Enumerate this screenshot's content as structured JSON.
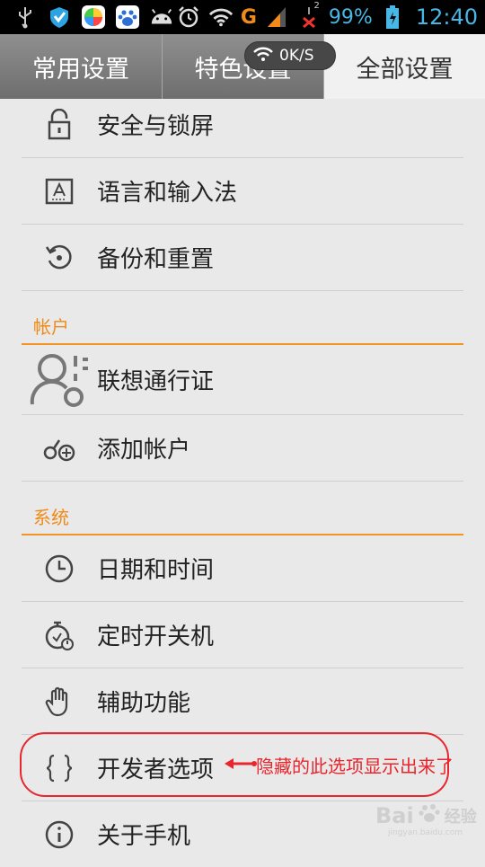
{
  "status_bar": {
    "battery": "99%",
    "time": "12:40",
    "network": "G",
    "signal_sub": "2",
    "icons": [
      "usb-icon",
      "shield-icon",
      "app-store-icon",
      "baidu-icon",
      "android-icon",
      "alarm-icon",
      "wifi-icon",
      "signal-icon",
      "no-sim-icon",
      "battery-icon"
    ],
    "accent": "#49b7e5"
  },
  "tabs": [
    {
      "label": "常用设置",
      "active": false
    },
    {
      "label": "特色设置",
      "active": false
    },
    {
      "label": "全部设置",
      "active": true
    }
  ],
  "speed_badge": "0K/S",
  "sections": {
    "account": "帐户",
    "system": "系统"
  },
  "items": {
    "security": "安全与锁屏",
    "language": "语言和输入法",
    "backup": "备份和重置",
    "lenovo_id": "联想通行证",
    "add_account": "添加帐户",
    "date_time": "日期和时间",
    "scheduled_power": "定时开关机",
    "accessibility": "辅助功能",
    "developer": "开发者选项",
    "about": "关于手机"
  },
  "annotation": {
    "text": "隐藏的此选项显示出来了",
    "color": "#e8262d"
  },
  "watermark": {
    "brand": "Bai",
    "suffix": "经验",
    "sub": "jingyan.baidu.com"
  },
  "colors": {
    "section_accent": "#f08a18",
    "background": "#e9e9e9"
  }
}
